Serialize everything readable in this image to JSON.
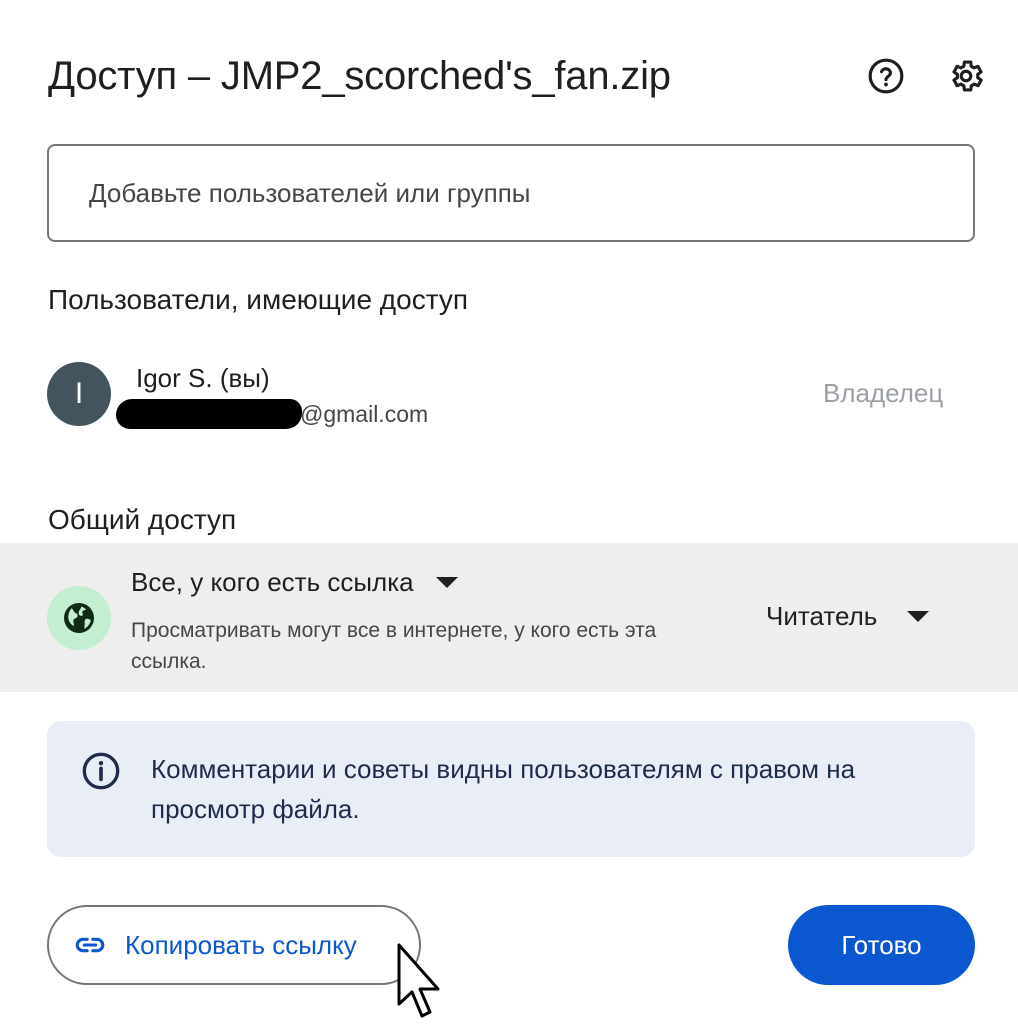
{
  "dialog": {
    "title": "Доступ – JMP2_scorched's_fan.zip",
    "header_icons": [
      "help-icon",
      "gear-icon"
    ]
  },
  "add_people": {
    "placeholder": "Добавьте пользователей или группы"
  },
  "people_section": {
    "heading": "Пользователи, имеющие доступ",
    "people": [
      {
        "avatar_letter": "I",
        "name": "Igor S. (вы)",
        "email_suffix": "@gmail.com",
        "role": "Владелец"
      }
    ]
  },
  "general_access": {
    "heading": "Общий доступ",
    "option": "Все, у кого есть ссылка",
    "description": "Просматривать могут все в интернете, у кого есть эта ссылка.",
    "role": "Читатель"
  },
  "info": {
    "text": "Комментарии и советы видны пользователям с правом на просмотр файла."
  },
  "actions": {
    "copy_link_label": "Копировать ссылку",
    "done_label": "Готово"
  },
  "colors": {
    "primary": "#0b57d0",
    "avatar_bg": "#44545f",
    "globe_bg": "#c4eed0",
    "info_bg": "#e9eef6",
    "general_row_bg": "#eeeeee"
  }
}
